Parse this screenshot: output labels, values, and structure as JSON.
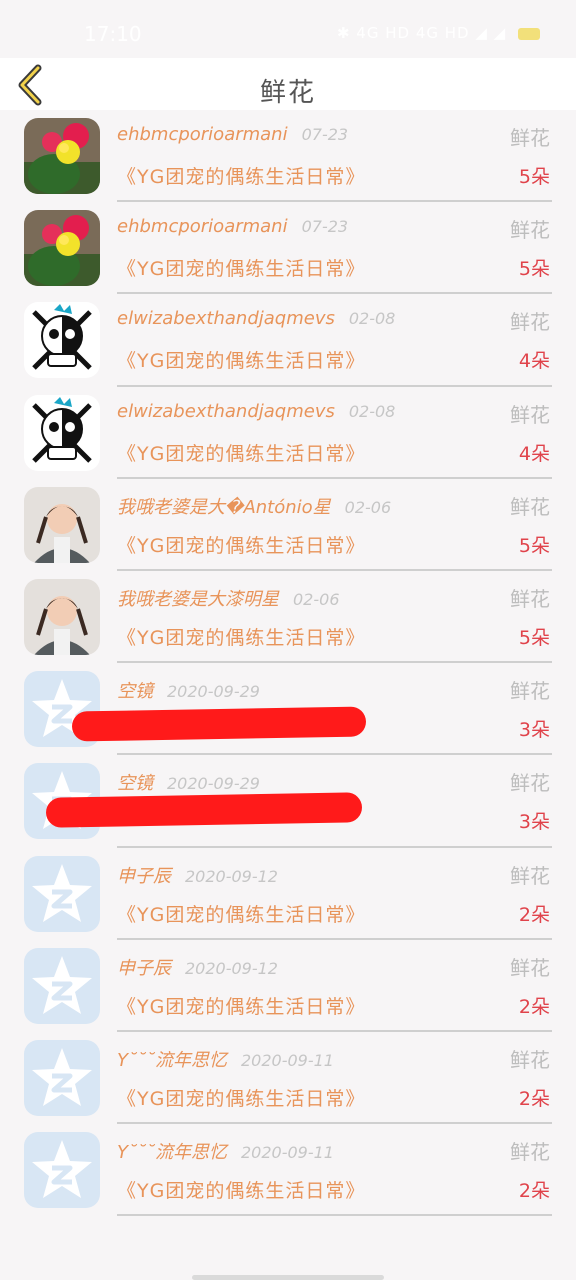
{
  "status": {
    "time": "17:10",
    "icons": "✱ 4G HD 4G HD ◢ ◢"
  },
  "header": {
    "title": "鲜花"
  },
  "colors": {
    "accent": "#e8945a",
    "count": "#e0434b",
    "muted": "#bdbdbd",
    "redaction": "#ff1a1a"
  },
  "gift_label": "鲜花",
  "records": [
    {
      "name": "ehbmcporioarmani",
      "date": "07-23",
      "message": "《YG团宠的偶练生活日常》",
      "count": "5朵",
      "avatar": "cactus-photo"
    },
    {
      "name": "ehbmcporioarmani",
      "date": "07-23",
      "message": "《YG团宠的偶练生活日常》",
      "count": "5朵",
      "avatar": "cactus-photo"
    },
    {
      "name": "elwizabexthandjaqmevs",
      "date": "02-08",
      "message": "《YG团宠的偶练生活日常》",
      "count": "4朵",
      "avatar": "skull-logo"
    },
    {
      "name": "elwizabexthandjaqmevs",
      "date": "02-08",
      "message": "《YG团宠的偶练生活日常》",
      "count": "4朵",
      "avatar": "skull-logo"
    },
    {
      "name": "我哦老婆是大�António星",
      "date": "02-06",
      "message": "《YG团宠的偶练生活日常》",
      "count": "5朵",
      "avatar": "girl-photo"
    },
    {
      "name": "我哦老婆是大漆明星",
      "date": "02-06",
      "message": "《YG团宠的偶练生活日常》",
      "count": "5朵",
      "avatar": "girl-photo"
    },
    {
      "name": "空镜",
      "date": "2020-09-29",
      "message": "",
      "count": "3朵",
      "avatar": "default-star"
    },
    {
      "name": "空镜",
      "date": "2020-09-29",
      "message": "",
      "count": "3朵",
      "avatar": "default-star"
    },
    {
      "name": "申子辰",
      "date": "2020-09-12",
      "message": "《YG团宠的偶练生活日常》",
      "count": "2朵",
      "avatar": "default-star"
    },
    {
      "name": "申子辰",
      "date": "2020-09-12",
      "message": "《YG团宠的偶练生活日常》",
      "count": "2朵",
      "avatar": "default-star"
    },
    {
      "name": "Y˘˘˘流年思忆",
      "date": "2020-09-11",
      "message": "《YG团宠的偶练生活日常》",
      "count": "2朵",
      "avatar": "default-star"
    },
    {
      "name": "Y˘˘˘流年思忆",
      "date": "2020-09-11",
      "message": "《YG团宠的偶练生活日常》",
      "count": "2朵",
      "avatar": "default-star"
    }
  ]
}
